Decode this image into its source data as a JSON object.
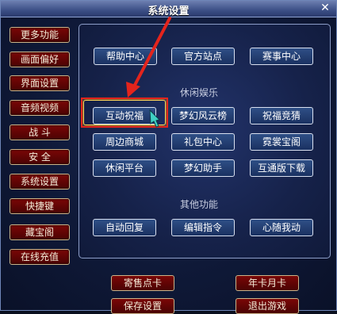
{
  "window": {
    "title": "系统设置"
  },
  "sidebar": {
    "items": [
      {
        "label": "更多功能"
      },
      {
        "label": "画面偏好"
      },
      {
        "label": "界面设置"
      },
      {
        "label": "音频视频"
      },
      {
        "label": "战 斗"
      },
      {
        "label": "安 全"
      },
      {
        "label": "系统设置"
      },
      {
        "label": "快捷键"
      },
      {
        "label": "藏宝阁"
      },
      {
        "label": "在线充值"
      }
    ]
  },
  "panel": {
    "top_buttons": [
      {
        "label": "帮助中心"
      },
      {
        "label": "官方站点"
      },
      {
        "label": "赛事中心"
      }
    ],
    "leisure_title": "休闲娱乐",
    "leisure_buttons": [
      {
        "label": "互动祝福"
      },
      {
        "label": "梦幻风云榜"
      },
      {
        "label": "祝福竞猜"
      },
      {
        "label": "周边商城"
      },
      {
        "label": "礼包中心"
      },
      {
        "label": "霓裳宝阁"
      },
      {
        "label": "休闲平台"
      },
      {
        "label": "梦幻助手"
      },
      {
        "label": "互通版下载"
      }
    ],
    "other_title": "其他功能",
    "other_buttons": [
      {
        "label": "自动回复"
      },
      {
        "label": "编辑指令"
      },
      {
        "label": "心随我动"
      }
    ]
  },
  "bottom": {
    "consign": "寄售点卡",
    "card": "年卡月卡",
    "save": "保存设置",
    "exit": "退出游戏"
  },
  "annotation": {
    "color": "#e4241c"
  }
}
